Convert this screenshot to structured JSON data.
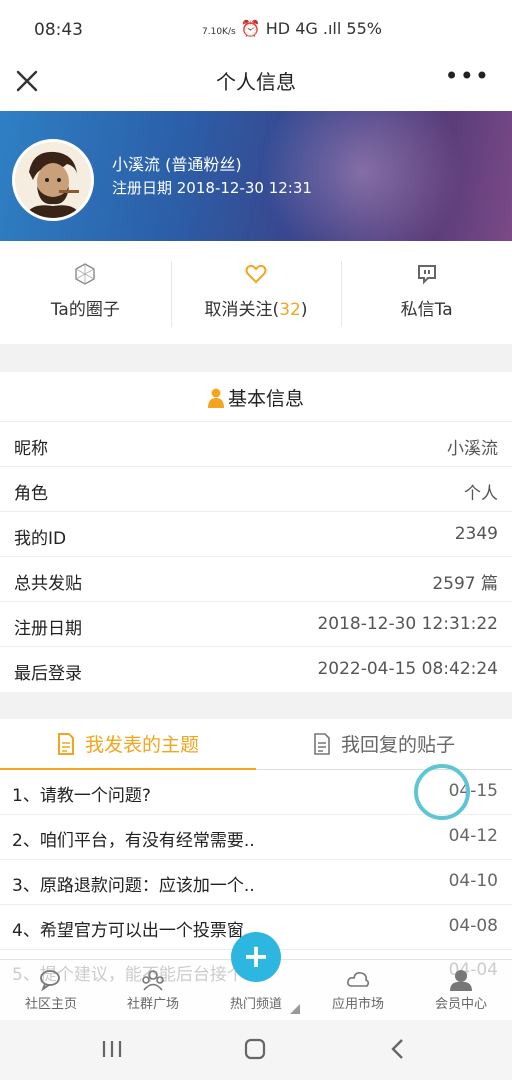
{
  "status_bar": {
    "time": "08:43",
    "speed": "7.10",
    "speed_unit": "K/s",
    "indicators": "⏰ HD 4G .ıll 55%"
  },
  "title_bar": {
    "title": "个人信息",
    "more": "•••"
  },
  "profile": {
    "name": "小溪流 (普通粉丝)",
    "register_line": "注册日期 2018-12-30 12:31"
  },
  "actions": [
    {
      "label": "Ta的圈子",
      "icon": "circle-icon"
    },
    {
      "label": "取消关注(",
      "count": "32",
      "suffix": ")",
      "icon": "heart-icon"
    },
    {
      "label": "私信Ta",
      "icon": "message-icon"
    }
  ],
  "basic_info": {
    "heading": "基本信息",
    "rows": [
      {
        "key": "昵称",
        "value": "小溪流"
      },
      {
        "key": "角色",
        "value": "个人"
      },
      {
        "key": "我的ID",
        "value": "2349"
      },
      {
        "key": "总共发贴",
        "value": "2597 篇"
      },
      {
        "key": "注册日期",
        "value": "2018-12-30 12:31:22"
      },
      {
        "key": "最后登录",
        "value": "2022-04-15 08:42:24"
      }
    ]
  },
  "posts": {
    "tabs": [
      "我发表的主题",
      "我回复的贴子"
    ],
    "items": [
      {
        "title": "1、请教一个问题?",
        "date": "04-15"
      },
      {
        "title": "2、咱们平台，有没有经常需要..",
        "date": "04-12"
      },
      {
        "title": "3、原路退款问题：应该加一个..",
        "date": "04-10"
      },
      {
        "title": "4、希望官方可以出一个投票窗..",
        "date": "04-08"
      },
      {
        "title": "5、提个建议，能不能后台接个..",
        "date": "04-04"
      }
    ]
  },
  "bottom_nav": [
    {
      "label": "社区主页",
      "icon": "chat-icon"
    },
    {
      "label": "社群广场",
      "icon": "group-icon"
    },
    {
      "label": "热门频道",
      "icon": "plus-icon"
    },
    {
      "label": "应用市场",
      "icon": "cloud-icon"
    },
    {
      "label": "会员中心",
      "icon": "user-icon"
    }
  ],
  "fab": "+",
  "colors": {
    "accent": "#f3a51e",
    "fab": "#2db7e0",
    "ring": "#5ec6d2"
  }
}
